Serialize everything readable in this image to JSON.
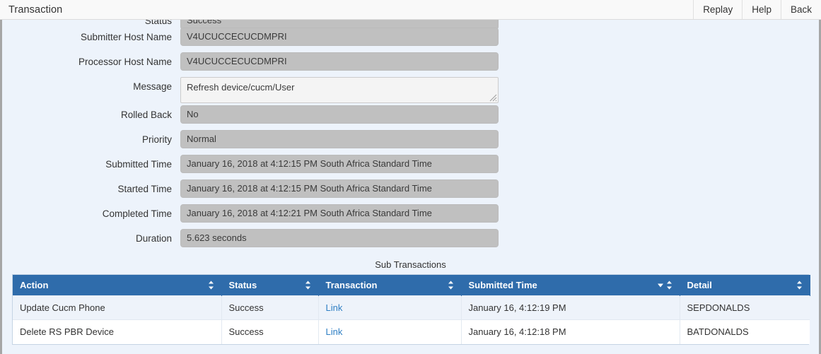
{
  "window": {
    "title": "Transaction",
    "actions": [
      {
        "label": "Replay",
        "name": "replay-button"
      },
      {
        "label": "Help",
        "name": "help-button"
      },
      {
        "label": "Back",
        "name": "back-button"
      }
    ]
  },
  "form": {
    "fields": [
      {
        "label": "Status",
        "value": "Success",
        "type": "readonly"
      },
      {
        "label": "Submitter Host Name",
        "value": "V4UCUCCECUCDMPRI",
        "type": "readonly"
      },
      {
        "label": "Processor Host Name",
        "value": "V4UCUCCECUCDMPRI",
        "type": "readonly"
      },
      {
        "label": "Message",
        "value": "Refresh device/cucm/User",
        "type": "textarea"
      },
      {
        "label": "Rolled Back",
        "value": "No",
        "type": "readonly"
      },
      {
        "label": "Priority",
        "value": "Normal",
        "type": "readonly"
      },
      {
        "label": "Submitted Time",
        "value": "January 16, 2018 at 4:12:15 PM South Africa Standard Time",
        "type": "readonly"
      },
      {
        "label": "Started Time",
        "value": "January 16, 2018 at 4:12:15 PM South Africa Standard Time",
        "type": "readonly"
      },
      {
        "label": "Completed Time",
        "value": "January 16, 2018 at 4:12:21 PM South Africa Standard Time",
        "type": "readonly"
      },
      {
        "label": "Duration",
        "value": "5.623 seconds",
        "type": "readonly"
      }
    ]
  },
  "sub_transactions": {
    "title": "Sub Transactions",
    "columns": [
      {
        "label": "Action",
        "sorted": false
      },
      {
        "label": "Status",
        "sorted": false
      },
      {
        "label": "Transaction",
        "sorted": false
      },
      {
        "label": "Submitted Time",
        "sorted": true,
        "sort_direction": "desc"
      },
      {
        "label": "Detail",
        "sorted": false
      }
    ],
    "rows": [
      {
        "action": "Update Cucm Phone",
        "status": "Success",
        "transaction": "Link",
        "submitted_time": "January 16, 4:12:19 PM",
        "detail": "SEPDONALDS"
      },
      {
        "action": "Delete RS PBR Device",
        "status": "Success",
        "transaction": "Link",
        "submitted_time": "January 16, 4:12:18 PM",
        "detail": "BATDONALDS"
      }
    ]
  },
  "colors": {
    "header_blue": "#2f6cab",
    "panel_bg": "#edf3fb",
    "field_bg": "#c0c0c0",
    "link": "#2f7fc4"
  }
}
